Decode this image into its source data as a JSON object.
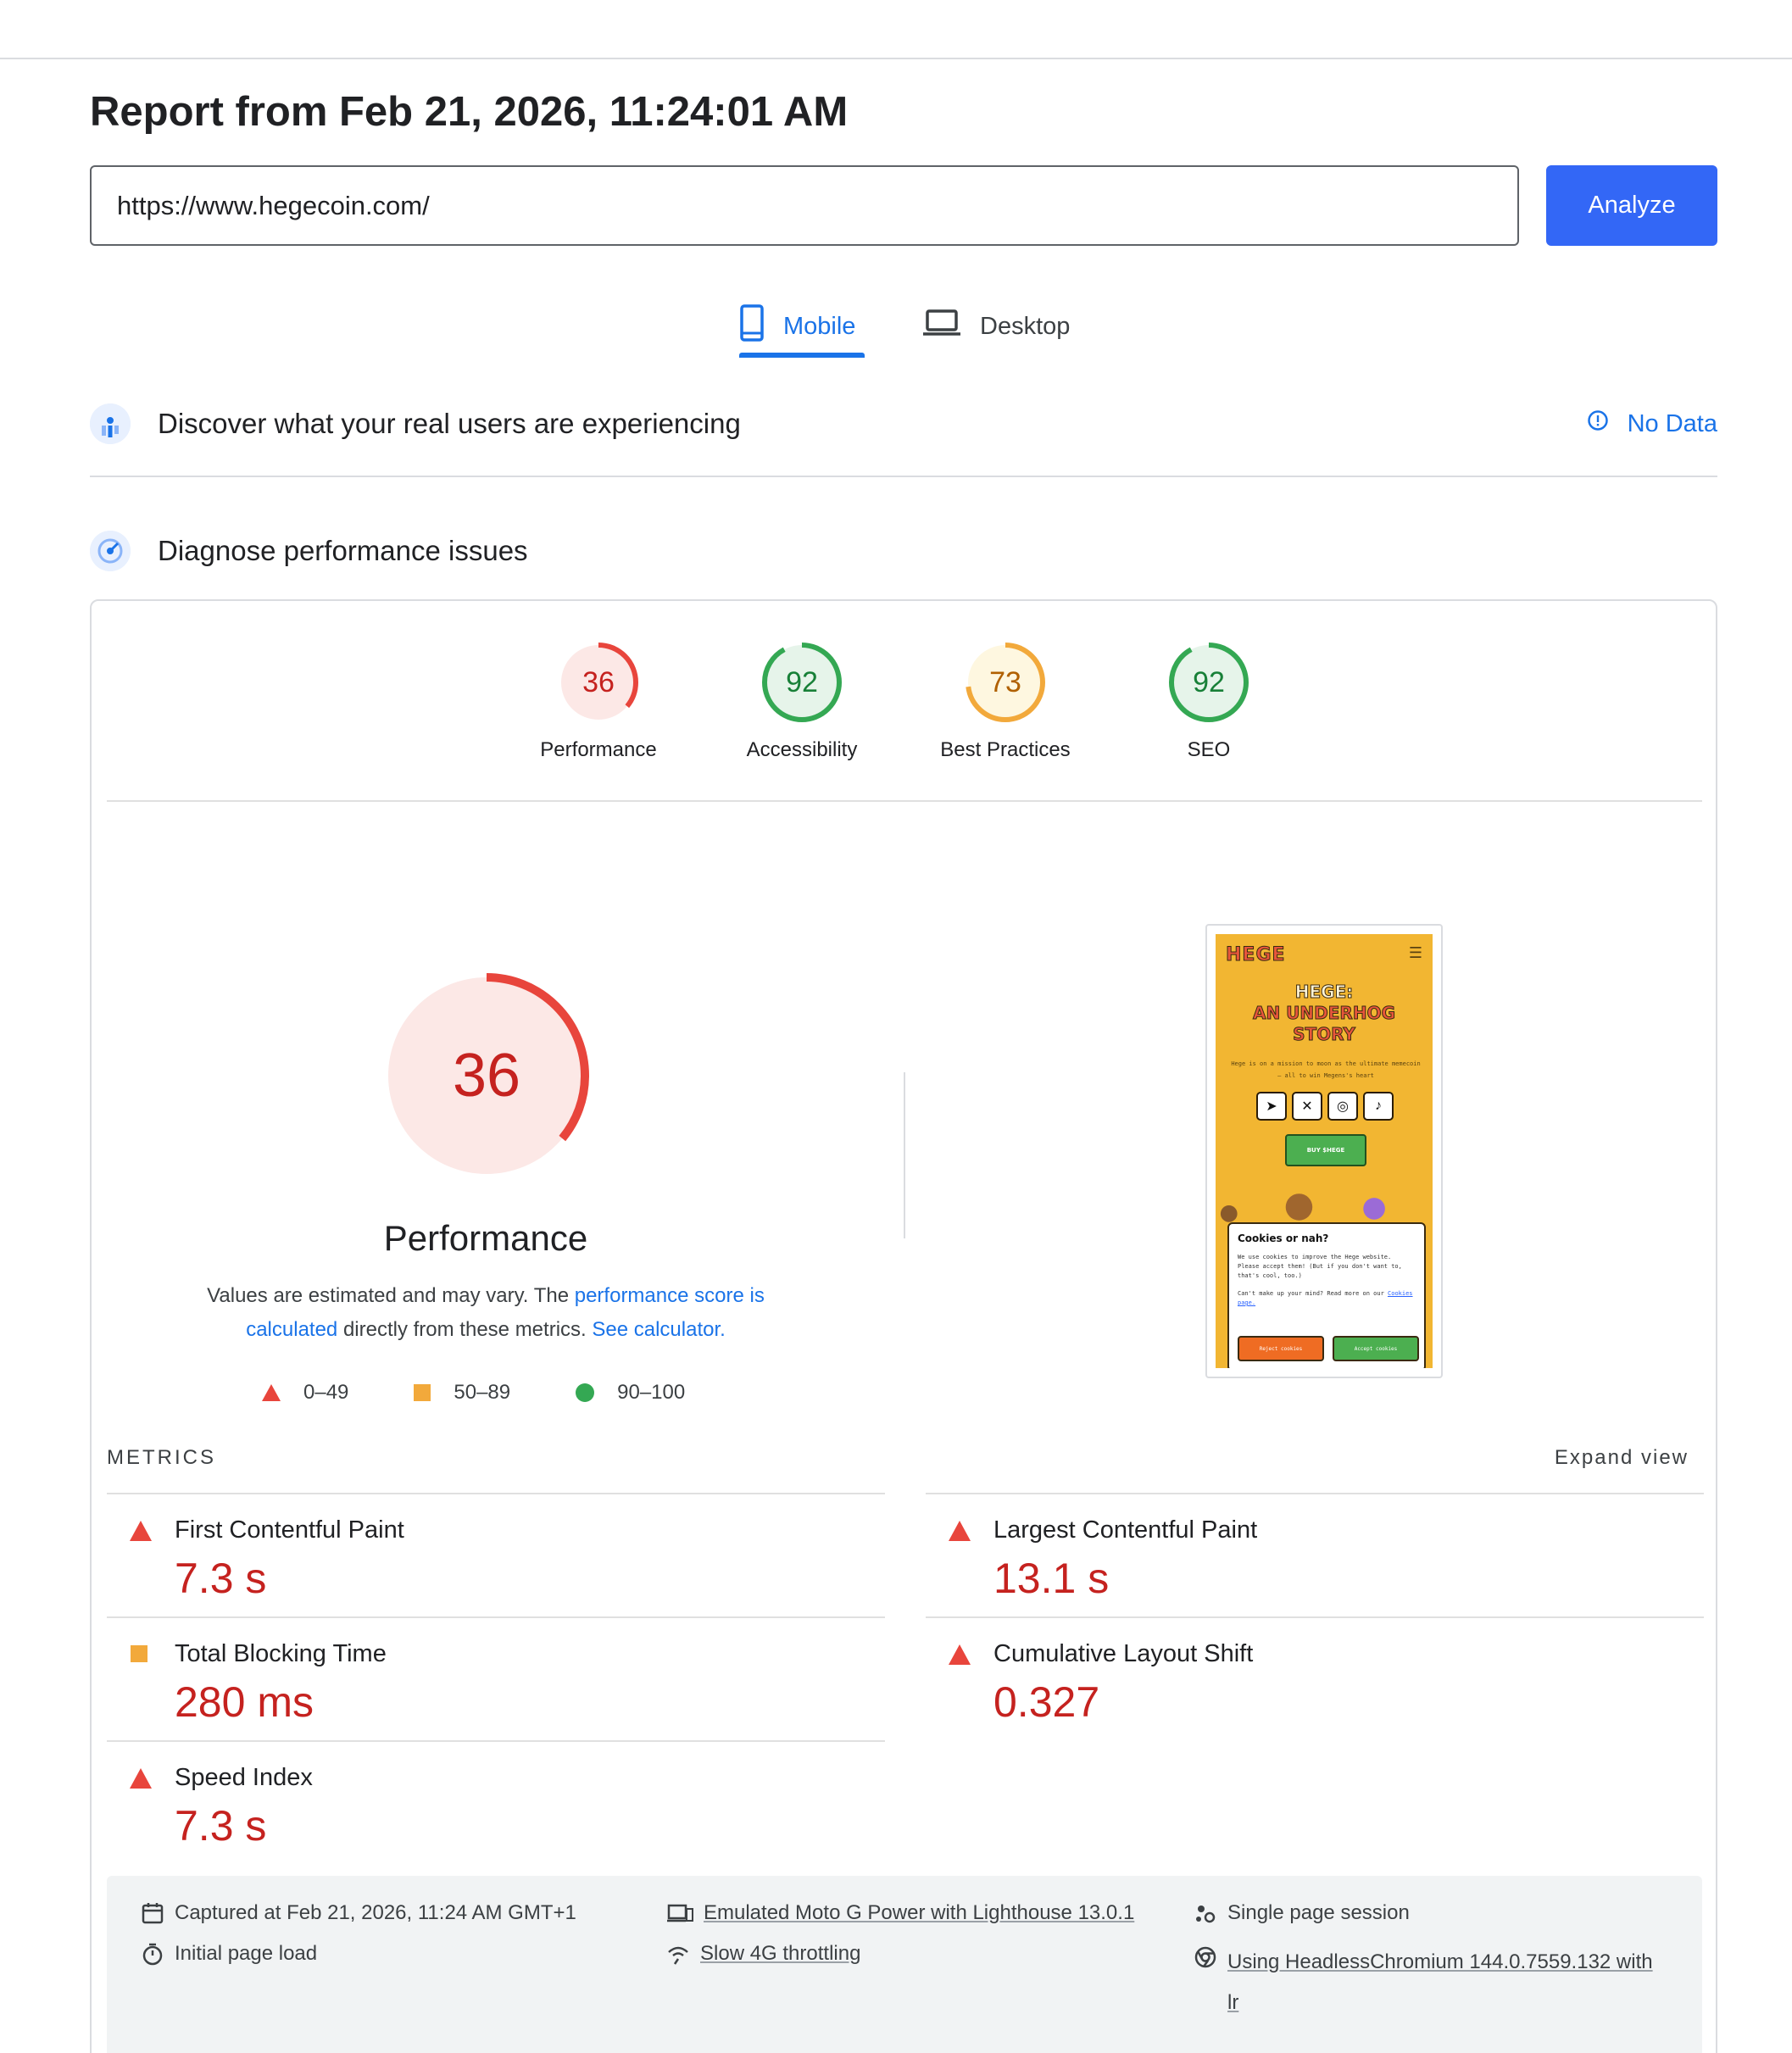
{
  "report": {
    "title": "Report from Feb 21, 2026, 11:24:01 AM"
  },
  "search": {
    "url": "https://www.hegecoin.com/",
    "analyze_label": "Analyze"
  },
  "tabs": [
    {
      "label": "Mobile",
      "active": true
    },
    {
      "label": "Desktop",
      "active": false
    }
  ],
  "field_data": {
    "title": "Discover what your real users are experiencing",
    "status": "No Data"
  },
  "diagnose": {
    "title": "Diagnose performance issues"
  },
  "scores": [
    {
      "label": "Performance",
      "value": 36,
      "color": "#e8453c",
      "bg": "#fce8e6"
    },
    {
      "label": "Accessibility",
      "value": 92,
      "color": "#34a853",
      "bg": "#e6f4ea"
    },
    {
      "label": "Best Practices",
      "value": 73,
      "color": "#f2a93b",
      "bg": "#fef7e0"
    },
    {
      "label": "SEO",
      "value": 92,
      "color": "#34a853",
      "bg": "#e6f4ea"
    }
  ],
  "performance": {
    "score": 36,
    "title": "Performance",
    "desc_1": "Values are estimated and may vary. The",
    "desc_link_1": "performance score is calculated",
    "desc_2": "directly from these metrics.",
    "desc_link_2": "See calculator.",
    "legend": [
      "0–49",
      "50–89",
      "90–100"
    ]
  },
  "screenshot": {
    "logo": "HEGE",
    "headline_1": "HEGE:",
    "headline_2": "AN UNDERHOG",
    "headline_3": "STORY",
    "tagline": "Hege is on a mission to moon as the ultimate memecoin – all to win Megens's heart",
    "buy_label": "BUY $HEGE",
    "cookie_title": "Cookies or nah?",
    "cookie_text": "We use cookies to improve the Hege website. Please accept them! (But if you don't want to, that's cool, too.)",
    "cookie_text_2": "Can't make up your mind? Read more on our",
    "cookie_link": "Cookies page.",
    "reject_label": "Reject cookies",
    "accept_label": "Accept cookies"
  },
  "metrics_header": {
    "label": "METRICS",
    "expand": "Expand view"
  },
  "metrics": [
    {
      "name": "First Contentful Paint",
      "value": "7.3 s",
      "rating": "poor"
    },
    {
      "name": "Largest Contentful Paint",
      "value": "13.1 s",
      "rating": "poor"
    },
    {
      "name": "Total Blocking Time",
      "value": "280 ms",
      "rating": "average"
    },
    {
      "name": "Cumulative Layout Shift",
      "value": "0.327",
      "rating": "poor"
    },
    {
      "name": "Speed Index",
      "value": "7.3 s",
      "rating": "poor"
    }
  ],
  "footer": {
    "captured": "Captured at Feb 21, 2026, 11:24 AM GMT+1",
    "load": "Initial page load",
    "device": "Emulated Moto G Power with Lighthouse 13.0.1",
    "throttle": "Slow 4G throttling",
    "session": "Single page session",
    "browser_1": "Using HeadlessChromium 144.0.7559.132 with",
    "browser_2": "lr"
  },
  "colors": {
    "accent": "#1a73e8",
    "button": "#3367f6",
    "poor": "#e8453c",
    "average": "#f2a93b",
    "good": "#34a853"
  }
}
